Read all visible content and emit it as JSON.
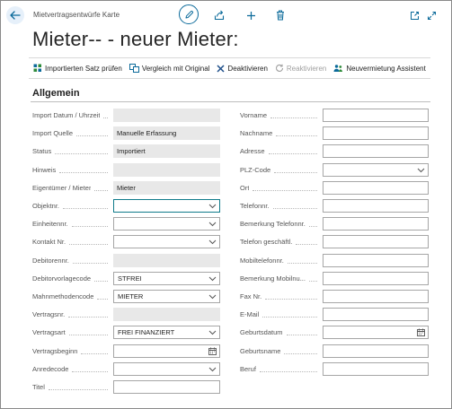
{
  "header": {
    "page_type": "Mietvertragsentwürfe Karte",
    "title": "Mieter-- - neuer Mieter:"
  },
  "actions": [
    {
      "label": "Importierten Satz prüfen",
      "icon": "import-check-icon",
      "disabled": false
    },
    {
      "label": "Vergleich mit Original",
      "icon": "compare-icon",
      "disabled": false
    },
    {
      "label": "Deaktivieren",
      "icon": "x-icon",
      "disabled": false
    },
    {
      "label": "Reaktivieren",
      "icon": "refresh-icon",
      "disabled": true
    },
    {
      "label": "Neuvermietung Assistent",
      "icon": "people-icon",
      "disabled": false
    }
  ],
  "section": {
    "title": "Allgemein"
  },
  "left_fields": [
    {
      "label": "Import Datum / Uhrzeit",
      "value": "",
      "type": "readonly"
    },
    {
      "label": "Import Quelle",
      "value": "Manuelle Erfassung",
      "type": "readonly"
    },
    {
      "label": "Status",
      "value": "Importiert",
      "type": "readonly"
    },
    {
      "label": "Hinweis",
      "value": "",
      "type": "readonly"
    },
    {
      "label": "Eigentümer / Mieter",
      "value": "Mieter",
      "type": "readonly"
    },
    {
      "label": "Objektnr.",
      "value": "",
      "type": "select",
      "focus": true
    },
    {
      "label": "Einheitennr.",
      "value": "",
      "type": "select"
    },
    {
      "label": "Kontakt Nr.",
      "value": "",
      "type": "select"
    },
    {
      "label": "Debitorennr.",
      "value": "",
      "type": "readonly"
    },
    {
      "label": "Debitorvorlagecode",
      "value": "STFREI",
      "type": "select"
    },
    {
      "label": "Mahnmethodencode",
      "value": "MIETER",
      "type": "select"
    },
    {
      "label": "Vertragsnr.",
      "value": "",
      "type": "readonly"
    },
    {
      "label": "Vertragsart",
      "value": "FREI FINANZIERT",
      "type": "select"
    },
    {
      "label": "Vertragsbeginn",
      "value": "",
      "type": "date"
    },
    {
      "label": "Anredecode",
      "value": "",
      "type": "select"
    },
    {
      "label": "Titel",
      "value": "",
      "type": "text"
    }
  ],
  "right_fields": [
    {
      "label": "Vorname",
      "value": "",
      "type": "text"
    },
    {
      "label": "Nachname",
      "value": "",
      "type": "text"
    },
    {
      "label": "Adresse",
      "value": "",
      "type": "text"
    },
    {
      "label": "PLZ-Code",
      "value": "",
      "type": "select"
    },
    {
      "label": "Ort",
      "value": "",
      "type": "text"
    },
    {
      "label": "Telefonnr.",
      "value": "",
      "type": "text"
    },
    {
      "label": "Bemerkung Telefonnr.",
      "value": "",
      "type": "text"
    },
    {
      "label": "Telefon geschäftl.",
      "value": "",
      "type": "text"
    },
    {
      "label": "Mobiltelefonnr.",
      "value": "",
      "type": "text"
    },
    {
      "label": "Bemerkung Mobilnu...",
      "value": "",
      "type": "text"
    },
    {
      "label": "Fax Nr.",
      "value": "",
      "type": "text"
    },
    {
      "label": "E-Mail",
      "value": "",
      "type": "text"
    },
    {
      "label": "Geburtsdatum",
      "value": "",
      "type": "date"
    },
    {
      "label": "Geburtsname",
      "value": "",
      "type": "text"
    },
    {
      "label": "Beruf",
      "value": "",
      "type": "text"
    }
  ],
  "colors": {
    "accent": "#0b6a9a",
    "readonly_bg": "#e8e8e8",
    "focus_border": "#0e7a8a"
  }
}
